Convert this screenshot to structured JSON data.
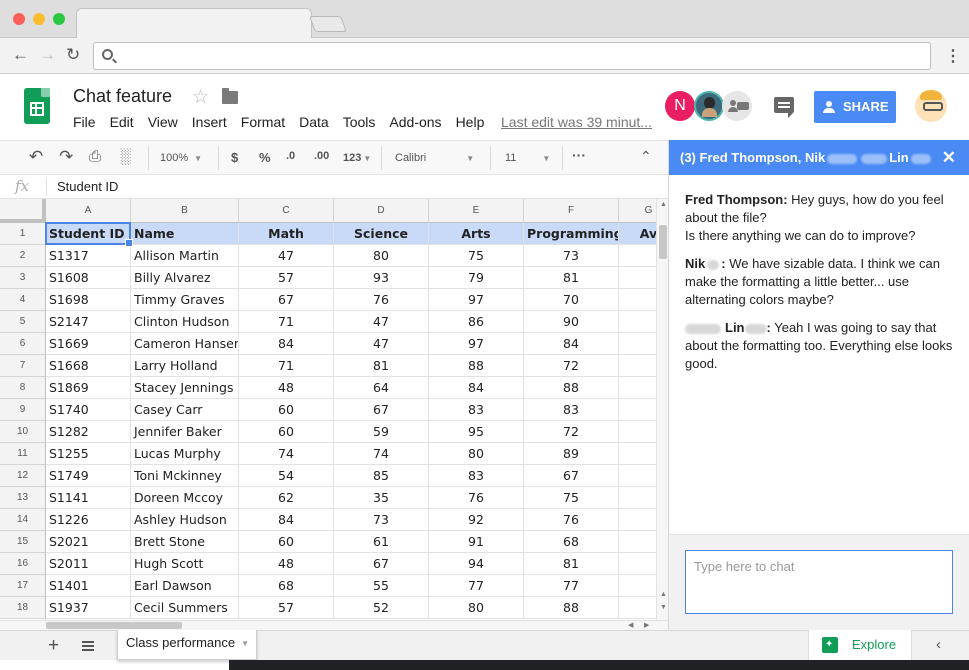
{
  "document": {
    "title": "Chat feature",
    "last_edit": "Last edit was 39 minut...",
    "menu": [
      "File",
      "Edit",
      "View",
      "Insert",
      "Format",
      "Data",
      "Tools",
      "Add-ons",
      "Help"
    ],
    "share_label": "SHARE",
    "collaborator_initial": "N"
  },
  "toolbar": {
    "zoom": "100%",
    "currency": "$",
    "percent": "%",
    "decrease_decimal": ".0",
    "increase_decimal": ".00",
    "more_formats": "123",
    "font": "Calibri",
    "font_size": "11",
    "more": "···"
  },
  "formula_bar": {
    "fx": "fx",
    "value": "Student ID"
  },
  "sheet": {
    "column_letters": [
      "A",
      "B",
      "C",
      "D",
      "E",
      "F",
      "G"
    ],
    "row_numbers": [
      "1",
      "2",
      "3",
      "4",
      "5",
      "6",
      "7",
      "8",
      "9",
      "10",
      "11",
      "12",
      "13",
      "14",
      "15",
      "16",
      "17",
      "18"
    ],
    "header": [
      "Student ID",
      "Name",
      "Math",
      "Science",
      "Arts",
      "Programming",
      "Av"
    ],
    "rows": [
      [
        "S1317",
        "Allison Martin",
        "47",
        "80",
        "75",
        "73"
      ],
      [
        "S1608",
        "Billy Alvarez",
        "57",
        "93",
        "79",
        "81"
      ],
      [
        "S1698",
        "Timmy Graves",
        "67",
        "76",
        "97",
        "70"
      ],
      [
        "S2147",
        "Clinton Hudson",
        "71",
        "47",
        "86",
        "90"
      ],
      [
        "S1669",
        "Cameron Hansen",
        "84",
        "47",
        "97",
        "84"
      ],
      [
        "S1668",
        "Larry Holland",
        "71",
        "81",
        "88",
        "72"
      ],
      [
        "S1869",
        "Stacey Jennings",
        "48",
        "64",
        "84",
        "88"
      ],
      [
        "S1740",
        "Casey Carr",
        "60",
        "67",
        "83",
        "83"
      ],
      [
        "S1282",
        "Jennifer Baker",
        "60",
        "59",
        "95",
        "72"
      ],
      [
        "S1255",
        "Lucas Murphy",
        "74",
        "74",
        "80",
        "89"
      ],
      [
        "S1749",
        "Toni Mckinney",
        "54",
        "85",
        "83",
        "67"
      ],
      [
        "S1141",
        "Doreen Mccoy",
        "62",
        "35",
        "76",
        "75"
      ],
      [
        "S1226",
        "Ashley Hudson",
        "84",
        "73",
        "92",
        "76"
      ],
      [
        "S2021",
        "Brett Stone",
        "60",
        "61",
        "91",
        "68"
      ],
      [
        "S2011",
        "Hugh Scott",
        "48",
        "67",
        "94",
        "81"
      ],
      [
        "S1401",
        "Earl Dawson",
        "68",
        "55",
        "77",
        "77"
      ],
      [
        "S1937",
        "Cecil Summers",
        "57",
        "52",
        "80",
        "88"
      ]
    ],
    "tab_name": "Class performance",
    "explore_label": "Explore"
  },
  "chat": {
    "header_count": "(3)",
    "header_name1": "Fred Thompson, Nik",
    "header_name2": "Lin",
    "messages": [
      {
        "author": "Fred Thompson:",
        "text": "Hey guys, how do you feel about the file?",
        "text2": "Is there anything we can do to improve?"
      },
      {
        "author": "Nik",
        "text": "We have sizable data. I think we can make the formatting a little better... use alternating colors maybe?"
      },
      {
        "author": "Lin",
        "text": "Yeah I was going to say that about the formatting too. Everything else looks good."
      }
    ],
    "input_placeholder": "Type here to chat"
  },
  "colors": {
    "accent_blue": "#4a8af4",
    "header_row_fill": "#c9daf8",
    "sheets_green": "#0f9d58",
    "collaborator_pink": "#e91e63"
  },
  "icons": [
    "back-icon",
    "forward-icon",
    "reload-icon",
    "search-icon",
    "kebab-menu-icon",
    "sheets-logo-icon",
    "star-icon",
    "folder-icon",
    "comments-icon",
    "undo-icon",
    "redo-icon",
    "print-icon",
    "paint-format-icon",
    "close-icon",
    "add-sheet-icon",
    "all-sheets-icon",
    "explore-icon",
    "chevron-left-icon"
  ]
}
